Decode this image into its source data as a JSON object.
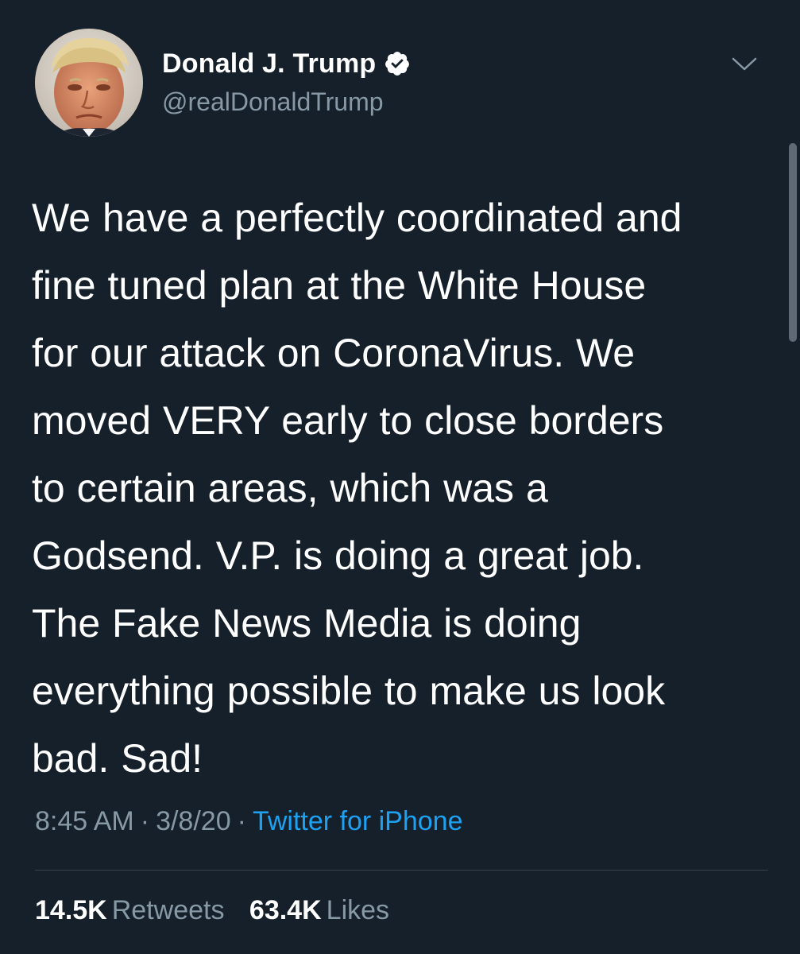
{
  "theme": {
    "background": "#15202b",
    "text": "#ffffff",
    "secondary_text": "#8899a6",
    "link": "#1da1f2",
    "divider": "#38444d"
  },
  "author": {
    "display_name": "Donald J. Trump",
    "handle": "@realDonaldTrump",
    "verified": true,
    "avatar_icon": "profile-photo",
    "verified_icon": "verified-badge-icon"
  },
  "menu_icon": "chevron-down-icon",
  "tweet": {
    "lines": [
      "We have a perfectly coordinated and",
      "fine tuned plan at the White House",
      "for our attack on CoronaVirus. We",
      "moved VERY early to close borders",
      "to certain areas, which was a",
      "Godsend. V.P. is doing a great job.",
      "The Fake News Media is doing",
      "everything possible to make us look",
      "bad. Sad!"
    ]
  },
  "meta": {
    "time": "8:45 AM",
    "separator": "·",
    "date": "3/8/20",
    "source": "Twitter for iPhone"
  },
  "stats": {
    "retweets_count": "14.5K",
    "retweets_label": "Retweets",
    "likes_count": "63.4K",
    "likes_label": "Likes"
  }
}
